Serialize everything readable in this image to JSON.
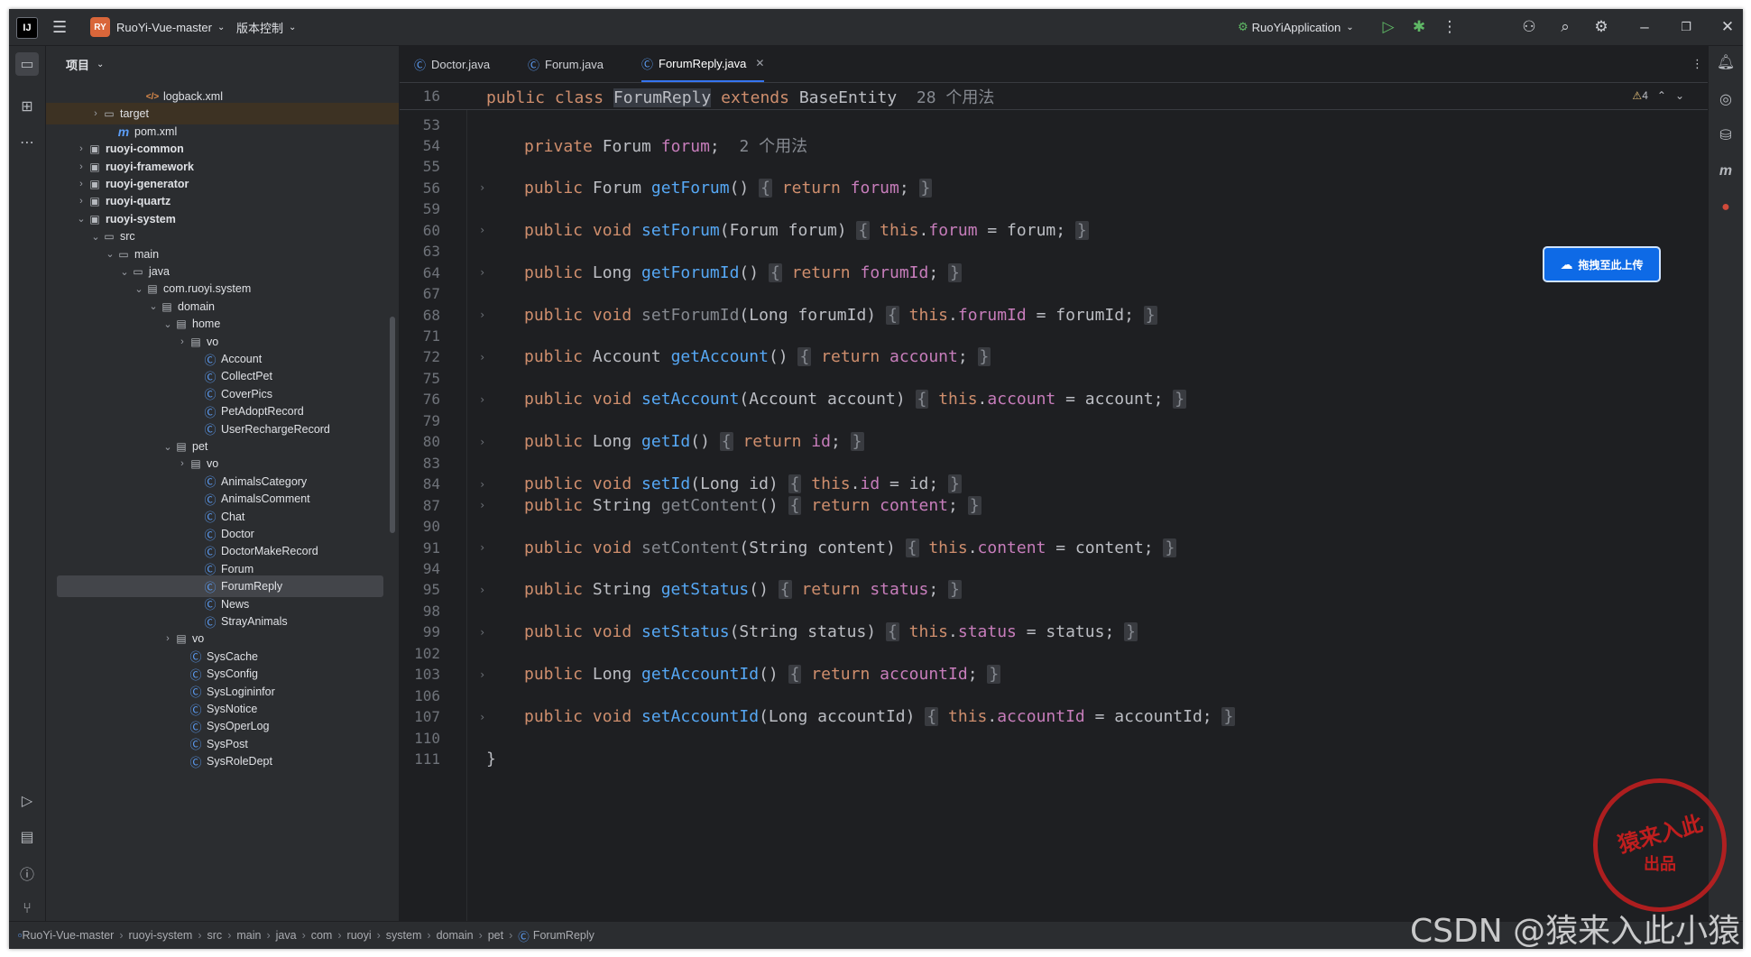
{
  "titlebar": {
    "app_logo": "IJ",
    "project_badge": "RY",
    "project_name": "RuoYi-Vue-master",
    "vcs_label": "版本控制",
    "run_config": "RuoYiApplication"
  },
  "project_panel": {
    "title": "项目",
    "tree": [
      {
        "label": "logback.xml",
        "type": "xml",
        "indent": 5,
        "chevron": "",
        "bold": false
      },
      {
        "label": "target",
        "type": "folder",
        "indent": 2,
        "chevron": "›",
        "bold": false
      },
      {
        "label": "pom.xml",
        "type": "maven",
        "indent": 3,
        "chevron": "",
        "bold": false
      },
      {
        "label": "ruoyi-common",
        "type": "module",
        "indent": 1,
        "chevron": "›",
        "bold": true
      },
      {
        "label": "ruoyi-framework",
        "type": "module",
        "indent": 1,
        "chevron": "›",
        "bold": true
      },
      {
        "label": "ruoyi-generator",
        "type": "module",
        "indent": 1,
        "chevron": "›",
        "bold": true
      },
      {
        "label": "ruoyi-quartz",
        "type": "module",
        "indent": 1,
        "chevron": "›",
        "bold": true
      },
      {
        "label": "ruoyi-system",
        "type": "module",
        "indent": 1,
        "chevron": "⌄",
        "bold": true
      },
      {
        "label": "src",
        "type": "folder",
        "indent": 2,
        "chevron": "⌄",
        "bold": false
      },
      {
        "label": "main",
        "type": "folder",
        "indent": 3,
        "chevron": "⌄",
        "bold": false
      },
      {
        "label": "java",
        "type": "folder",
        "indent": 4,
        "chevron": "⌄",
        "bold": false
      },
      {
        "label": "com.ruoyi.system",
        "type": "package",
        "indent": 5,
        "chevron": "⌄",
        "bold": false
      },
      {
        "label": "domain",
        "type": "package",
        "indent": 6,
        "chevron": "⌄",
        "bold": false
      },
      {
        "label": "home",
        "type": "package",
        "indent": 7,
        "chevron": "⌄",
        "bold": false
      },
      {
        "label": "vo",
        "type": "package",
        "indent": 8,
        "chevron": "›",
        "bold": false
      },
      {
        "label": "Account",
        "type": "class",
        "indent": 9,
        "chevron": "",
        "bold": false
      },
      {
        "label": "CollectPet",
        "type": "class",
        "indent": 9,
        "chevron": "",
        "bold": false
      },
      {
        "label": "CoverPics",
        "type": "class",
        "indent": 9,
        "chevron": "",
        "bold": false
      },
      {
        "label": "PetAdoptRecord",
        "type": "class",
        "indent": 9,
        "chevron": "",
        "bold": false
      },
      {
        "label": "UserRechargeRecord",
        "type": "class",
        "indent": 9,
        "chevron": "",
        "bold": false
      },
      {
        "label": "pet",
        "type": "package",
        "indent": 7,
        "chevron": "⌄",
        "bold": false
      },
      {
        "label": "vo",
        "type": "package",
        "indent": 8,
        "chevron": "›",
        "bold": false
      },
      {
        "label": "AnimalsCategory",
        "type": "class",
        "indent": 9,
        "chevron": "",
        "bold": false
      },
      {
        "label": "AnimalsComment",
        "type": "class",
        "indent": 9,
        "chevron": "",
        "bold": false
      },
      {
        "label": "Chat",
        "type": "class",
        "indent": 9,
        "chevron": "",
        "bold": false
      },
      {
        "label": "Doctor",
        "type": "class",
        "indent": 9,
        "chevron": "",
        "bold": false
      },
      {
        "label": "DoctorMakeRecord",
        "type": "class",
        "indent": 9,
        "chevron": "",
        "bold": false
      },
      {
        "label": "Forum",
        "type": "class",
        "indent": 9,
        "chevron": "",
        "bold": false
      },
      {
        "label": "ForumReply",
        "type": "class",
        "indent": 9,
        "chevron": "",
        "bold": false
      },
      {
        "label": "News",
        "type": "class",
        "indent": 9,
        "chevron": "",
        "bold": false
      },
      {
        "label": "StrayAnimals",
        "type": "class",
        "indent": 9,
        "chevron": "",
        "bold": false
      },
      {
        "label": "vo",
        "type": "package",
        "indent": 7,
        "chevron": "›",
        "bold": false
      },
      {
        "label": "SysCache",
        "type": "class",
        "indent": 8,
        "chevron": "",
        "bold": false
      },
      {
        "label": "SysConfig",
        "type": "class",
        "indent": 8,
        "chevron": "",
        "bold": false
      },
      {
        "label": "SysLogininfor",
        "type": "class",
        "indent": 8,
        "chevron": "",
        "bold": false
      },
      {
        "label": "SysNotice",
        "type": "class",
        "indent": 8,
        "chevron": "",
        "bold": false
      },
      {
        "label": "SysOperLog",
        "type": "class",
        "indent": 8,
        "chevron": "",
        "bold": false
      },
      {
        "label": "SysPost",
        "type": "class",
        "indent": 8,
        "chevron": "",
        "bold": false
      },
      {
        "label": "SysRoleDept",
        "type": "class",
        "indent": 8,
        "chevron": "",
        "bold": false
      }
    ],
    "selected_label": "ForumReply"
  },
  "tabs": [
    {
      "label": "Doctor.java",
      "active": false
    },
    {
      "label": "Forum.java",
      "active": false
    },
    {
      "label": "ForumReply.java",
      "active": true
    }
  ],
  "editor": {
    "sticky_line_number": "16",
    "sticky": {
      "kw1": "public class ",
      "cls": "ForumReply",
      "kw2": " extends ",
      "base": "BaseEntity",
      "hint": "  28 个用法"
    },
    "warnings": "4",
    "lines": [
      {
        "n": "53",
        "t": "blank"
      },
      {
        "n": "54",
        "t": "field",
        "type": "Forum",
        "name": "forum",
        "hint": "2 个用法"
      },
      {
        "n": "55",
        "t": "blank"
      },
      {
        "n": "56",
        "t": "getter",
        "ret": "Forum",
        "fn": "getForum",
        "field": "forum",
        "dim": false
      },
      {
        "n": "59",
        "t": "blank"
      },
      {
        "n": "60",
        "t": "setter",
        "fn": "setForum",
        "ptype": "Forum",
        "param": "forum",
        "field": "forum",
        "dim": false
      },
      {
        "n": "63",
        "t": "blank"
      },
      {
        "n": "64",
        "t": "getter",
        "ret": "Long",
        "fn": "getForumId",
        "field": "forumId",
        "dim": false
      },
      {
        "n": "67",
        "t": "blank"
      },
      {
        "n": "68",
        "t": "setter",
        "fn": "setForumId",
        "ptype": "Long",
        "param": "forumId",
        "field": "forumId",
        "dim": true
      },
      {
        "n": "71",
        "t": "blank"
      },
      {
        "n": "72",
        "t": "getter",
        "ret": "Account",
        "fn": "getAccount",
        "field": "account",
        "dim": false
      },
      {
        "n": "75",
        "t": "blank"
      },
      {
        "n": "76",
        "t": "setter",
        "fn": "setAccount",
        "ptype": "Account",
        "param": "account",
        "field": "account",
        "dim": false
      },
      {
        "n": "79",
        "t": "blank"
      },
      {
        "n": "80",
        "t": "getter",
        "ret": "Long",
        "fn": "getId",
        "field": "id",
        "dim": false
      },
      {
        "n": "83",
        "t": "blank"
      },
      {
        "n": "84",
        "t": "setter",
        "fn": "setId",
        "ptype": "Long",
        "param": "id",
        "field": "id",
        "dim": false
      },
      {
        "n": "87",
        "t": "getter",
        "ret": "String",
        "fn": "getContent",
        "field": "content",
        "dim": true
      },
      {
        "n": "90",
        "t": "blank"
      },
      {
        "n": "91",
        "t": "setter",
        "fn": "setContent",
        "ptype": "String",
        "param": "content",
        "field": "content",
        "dim": true
      },
      {
        "n": "94",
        "t": "blank"
      },
      {
        "n": "95",
        "t": "getter",
        "ret": "String",
        "fn": "getStatus",
        "field": "status",
        "dim": false
      },
      {
        "n": "98",
        "t": "blank"
      },
      {
        "n": "99",
        "t": "setter",
        "fn": "setStatus",
        "ptype": "String",
        "param": "status",
        "field": "status",
        "dim": false
      },
      {
        "n": "102",
        "t": "blank"
      },
      {
        "n": "103",
        "t": "getter",
        "ret": "Long",
        "fn": "getAccountId",
        "field": "accountId",
        "dim": false
      },
      {
        "n": "106",
        "t": "blank"
      },
      {
        "n": "107",
        "t": "setter",
        "fn": "setAccountId",
        "ptype": "Long",
        "param": "accountId",
        "field": "accountId",
        "dim": false
      },
      {
        "n": "110",
        "t": "blank"
      },
      {
        "n": "111",
        "t": "close"
      }
    ]
  },
  "upload_button": "拖拽至此上传",
  "breadcrumbs": [
    "RuoYi-Vue-master",
    "ruoyi-system",
    "src",
    "main",
    "java",
    "com",
    "ruoyi",
    "system",
    "domain",
    "pet",
    "ForumReply"
  ],
  "watermark": {
    "text": "CSDN @猿来入此小猿",
    "seal_line1": "猿来入此",
    "seal_line2": "出品"
  },
  "colors": {
    "keyword": "#cf8e6d",
    "function": "#56a8f5",
    "field": "#c77dbb",
    "background": "#1e1f22",
    "accent": "#3574f0"
  }
}
